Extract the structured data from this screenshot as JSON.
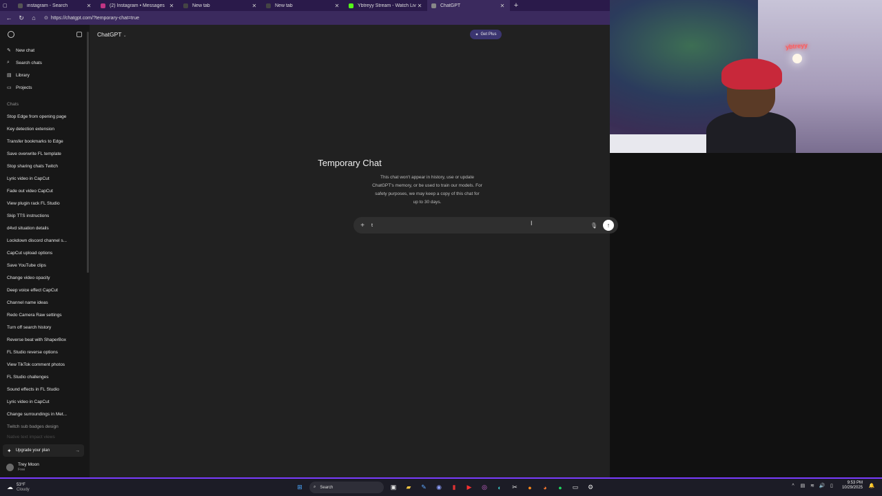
{
  "browser": {
    "tabs": [
      {
        "label": "instagram - Search",
        "color": "#555555",
        "active": false
      },
      {
        "label": "(2) Instagram • Messages",
        "color": "#c13584",
        "active": false
      },
      {
        "label": "New tab",
        "color": "#444444",
        "active": false
      },
      {
        "label": "New tab",
        "color": "#444444",
        "active": false
      },
      {
        "label": "Ybtreyy Stream - Watch Live on K",
        "color": "#53fc18",
        "active": false
      },
      {
        "label": "ChatGPT",
        "color": "#888888",
        "active": true
      }
    ],
    "url": "https://chatgpt.com/?temporary-chat=true"
  },
  "webcam": {
    "neon_sign": "ybtreyy"
  },
  "sidebar": {
    "items": [
      {
        "label": "New chat",
        "icon": "pencil-icon"
      },
      {
        "label": "Search chats",
        "icon": "search-icon"
      },
      {
        "label": "Library",
        "icon": "library-icon"
      },
      {
        "label": "Projects",
        "icon": "folder-icon"
      }
    ],
    "section_label": "Chats",
    "chats": [
      "Stop Edge from opening page",
      "Key detection extension",
      "Transfer bookmarks to Edge",
      "Save overwrite FL template",
      "Stop sharing chats Twitch",
      "Lyric video in CapCut",
      "Fade out video CapCut",
      "View plugin rack FL Studio",
      "Skip TTS instructions",
      "d4vd situation details",
      "Lockdown discord channel s...",
      "CapCut upload options",
      "Save YouTube clips",
      "Change video opacity",
      "Deep voice effect CapCut",
      "Channel name ideas",
      "Redo Camera Raw settings",
      "Turn off search history",
      "Reverse beat with ShaperBox",
      "FL Studio reverse options",
      "View TikTok comment photos",
      "FL Studio challenges",
      "Sound effects in FL Studio",
      "Lyric video in CapCut",
      "Change surroundings in Met..."
    ],
    "chats_dim": "Twitch sub badges design",
    "chats_fade": "Native text impact views",
    "upgrade_label": "Upgrade your plan",
    "user_name": "Trey Moon",
    "user_plan": "Free"
  },
  "main": {
    "model_label": "ChatGPT",
    "get_plus_label": "Get Plus",
    "title": "Temporary Chat",
    "description": "This chat won't appear in history, use or update ChatGPT's memory, or be used to train our models. For safety purposes, we may keep a copy of this chat for up to 30 days.",
    "composer_value": "t"
  },
  "taskbar": {
    "temp": "53°F",
    "condition": "Cloudy",
    "search_label": "Search",
    "time": "9:53 PM",
    "date": "10/29/2025"
  }
}
